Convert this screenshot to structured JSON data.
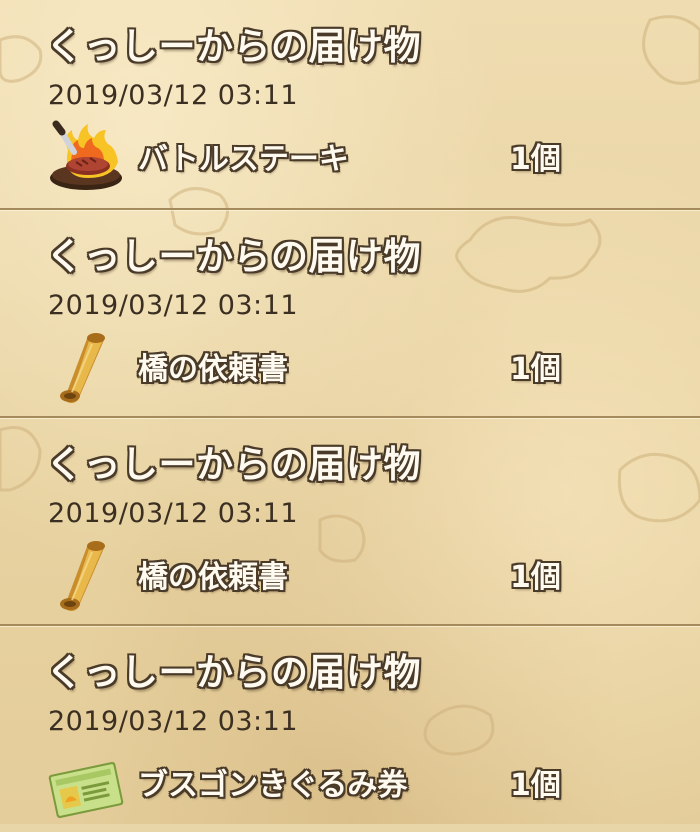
{
  "mails": [
    {
      "title": "くっしーからの届け物",
      "date": "2019/03/12 03:11",
      "item": {
        "name": "バトルステーキ",
        "quantity": "1個",
        "icon": "steak-icon"
      }
    },
    {
      "title": "くっしーからの届け物",
      "date": "2019/03/12 03:11",
      "item": {
        "name": "橋の依頼書",
        "quantity": "1個",
        "icon": "scroll-icon"
      }
    },
    {
      "title": "くっしーからの届け物",
      "date": "2019/03/12 03:11",
      "item": {
        "name": "橋の依頼書",
        "quantity": "1個",
        "icon": "scroll-icon"
      }
    },
    {
      "title": "くっしーからの届け物",
      "date": "2019/03/12 03:11",
      "item": {
        "name": "ブスゴンきぐるみ券",
        "quantity": "1個",
        "icon": "ticket-icon"
      }
    }
  ],
  "colors": {
    "parchment": "#e9d6a8",
    "divider": "#a58a5c",
    "text_outline": "#4a3a28",
    "text_fill": "#fffaf0",
    "date_text": "#3b2f22"
  }
}
